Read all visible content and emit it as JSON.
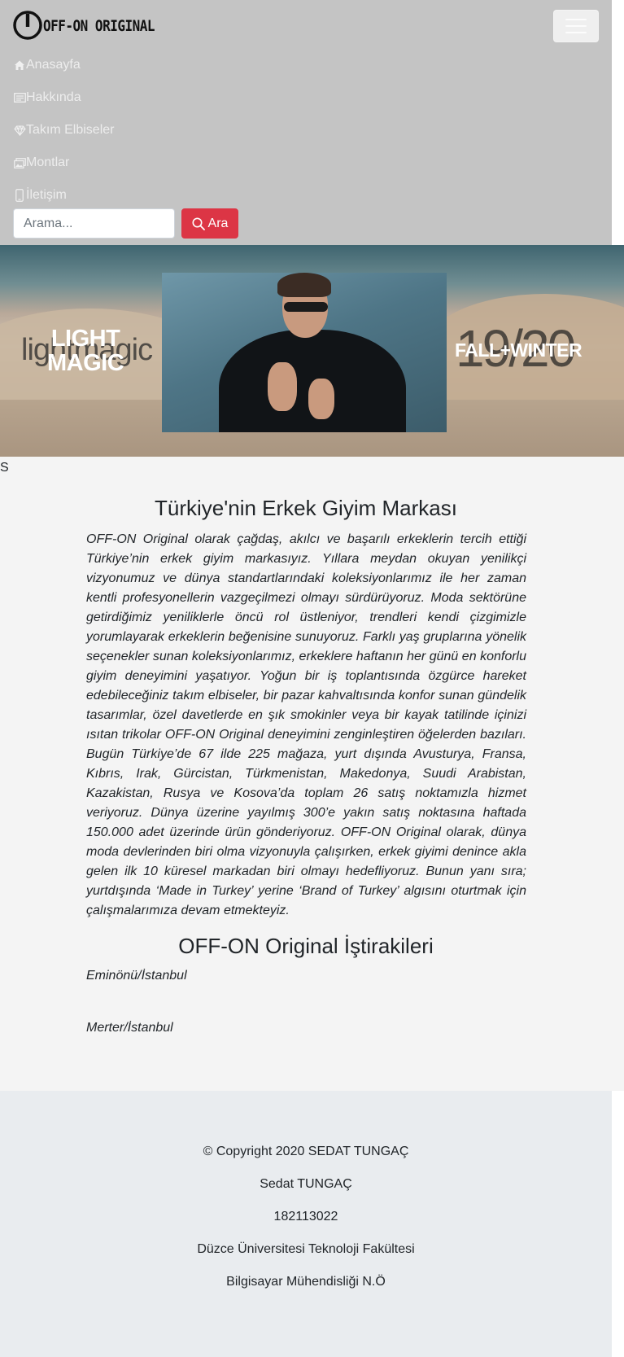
{
  "navbar": {
    "brand_text": "OFF-ON ORIGINAL",
    "items": [
      {
        "label": "Anasayfa",
        "icon": "house-icon"
      },
      {
        "label": "Hakkında",
        "icon": "newspaper-icon"
      },
      {
        "label": "Takım Elbiseler",
        "icon": "gem-icon"
      },
      {
        "label": "Montlar",
        "icon": "images-icon"
      },
      {
        "label": "İletişim",
        "icon": "phone-icon"
      }
    ],
    "search_placeholder": "Arama...",
    "search_button_label": "Ara"
  },
  "hero": {
    "left_ghost": "lightmagic",
    "left_line1": "LIGHT",
    "left_line2": "MAGIC",
    "right_ghost": "19/20",
    "right_text": "FALL+WINTER"
  },
  "stray_text": "S",
  "about": {
    "title": "Türkiye'nin Erkek Giyim Markası",
    "text": "OFF-ON Original olarak çağdaş, akılcı ve başarılı erkeklerin tercih ettiği Türkiye’nin erkek giyim markasıyız. Yıllara meydan okuyan yenilikçi vizyonumuz ve dünya standartlarındaki koleksiyonlarımız ile her zaman kentli profesyonellerin vazgeçilmezi olmayı sürdürüyoruz. Moda sektörüne getirdiğimiz yeniliklerle öncü rol üstleniyor, trendleri kendi çizgimizle yorumlayarak erkeklerin beğenisine sunuyoruz. Farklı yaş gruplarına yönelik seçenekler sunan koleksiyonlarımız, erkeklere haftanın her günü en konforlu giyim deneyimini yaşatıyor. Yoğun bir iş toplantısında özgürce hareket edebileceğiniz takım elbiseler, bir pazar kahvaltısında konfor sunan gündelik tasarımlar, özel davetlerde en şık smokinler veya bir kayak tatilinde içinizi ısıtan trikolar OFF-ON Original deneyimini zenginleştiren öğelerden bazıları. Bugün Türkiye’de 67 ilde 225 mağaza, yurt dışında Avusturya, Fransa, Kıbrıs, Irak, Gürcistan, Türkmenistan, Makedonya, Suudi Arabistan, Kazakistan, Rusya ve Kosova’da toplam 26 satış noktamızla hizmet veriyoruz. Dünya üzerine yayılmış 300’e yakın satış noktasına haftada 150.000 adet üzerinde ürün gönderiyoruz. OFF-ON Original olarak, dünya moda devlerinden biri olma vizyonuyla çalışırken, erkek giyimi denince akla gelen ilk 10 küresel markadan biri olmayı hedefliyoruz. Bunun yanı sıra; yurtdışında ‘Made in Turkey’ yerine ‘Brand of Turkey’ algısını oturtmak için çalışmalarımıza devam etmekteyiz."
  },
  "branches": {
    "title": "OFF-ON Original İştirakileri",
    "items": [
      "Eminönü/İstanbul",
      "Merter/İstanbul"
    ]
  },
  "footer": {
    "lines": [
      "© Copyright 2020 SEDAT TUNGAÇ",
      "Sedat TUNGAÇ",
      "182113022",
      "Düzce Üniversitesi Teknoloji Fakültesi",
      "Bilgisayar Mühendisliği N.Ö"
    ]
  },
  "colors": {
    "navbar_bg": "#c4c4c4",
    "search_button": "#dc3545",
    "main_bg": "#f4f4f4",
    "footer_bg": "#e9ecef"
  }
}
